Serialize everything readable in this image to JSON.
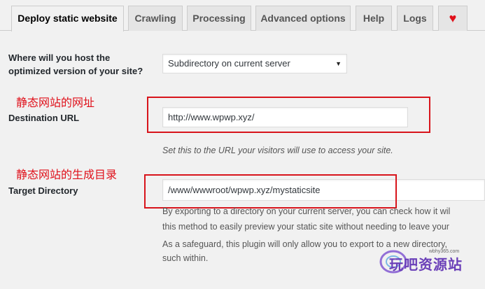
{
  "tabs": [
    {
      "label": "Deploy static website"
    },
    {
      "label": "Crawling"
    },
    {
      "label": "Processing"
    },
    {
      "label": "Advanced options"
    },
    {
      "label": "Help"
    },
    {
      "label": "Logs"
    },
    {
      "label": "♥"
    }
  ],
  "host": {
    "label_line1": "Where will you host the",
    "label_line2": "optimized version of your site?",
    "selected": "Subdirectory on current server"
  },
  "destination": {
    "annotation": "静态网站的网址",
    "label": "Destination URL",
    "value": "http://www.wpwp.xyz/",
    "help": "Set this to the URL your visitors will use to access your site."
  },
  "target": {
    "annotation": "静态网站的生成目录",
    "label": "Target Directory",
    "value": "/www/wwwroot/wpwp.xyz/mystaticsite",
    "desc_line1": "By exporting to a directory on your current server, you can check how it wil",
    "desc_line2": "this method to easily preview your static site without needing to leave your",
    "desc_line3": "As a safeguard, this plugin will only allow you to export to a new directory,",
    "desc_line4": "such within."
  },
  "watermark": {
    "tag": "wbhy365.com",
    "text": "玩吧资源站"
  },
  "colors": {
    "annotation_red": "#e0101a",
    "background": "#f1f1f1"
  }
}
